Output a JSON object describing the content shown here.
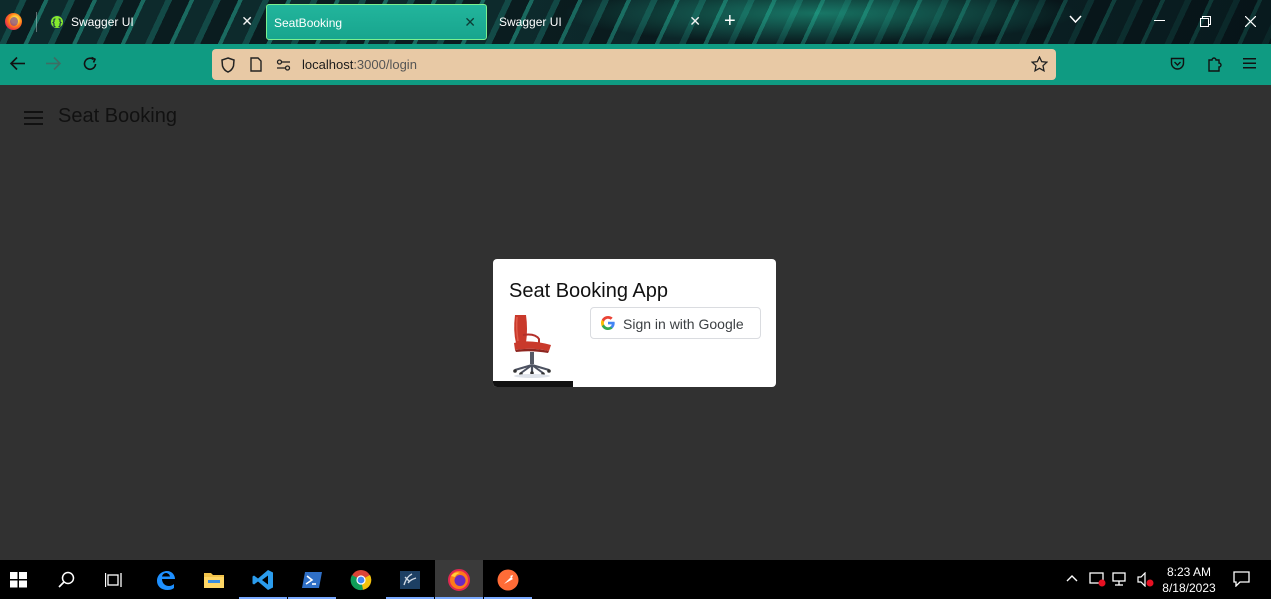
{
  "browser": {
    "tabs": [
      {
        "label": "Swagger UI",
        "active": false
      },
      {
        "label": "SeatBooking",
        "active": true
      },
      {
        "label": "Swagger UI",
        "active": false
      }
    ],
    "new_tab_symbol": "+",
    "url_host": "localhost",
    "url_rest": ":3000/login"
  },
  "app": {
    "title": "Seat Booking"
  },
  "login_card": {
    "title": "Seat Booking App",
    "google_button_label": "Sign in with Google"
  },
  "taskbar": {
    "apps": [
      "start",
      "search",
      "task-view",
      "edge",
      "file-explorer",
      "vscode",
      "powershell",
      "chrome",
      "sql-server-management-studio",
      "firefox",
      "postman"
    ],
    "active_app": "firefox",
    "clock_time": "8:23 AM",
    "clock_date": "8/18/2023"
  },
  "colors": {
    "nav_bar": "#0f9b82",
    "url_bar": "#e8c9a5",
    "page_background": "#313131",
    "active_tab": "#1aa88f"
  }
}
